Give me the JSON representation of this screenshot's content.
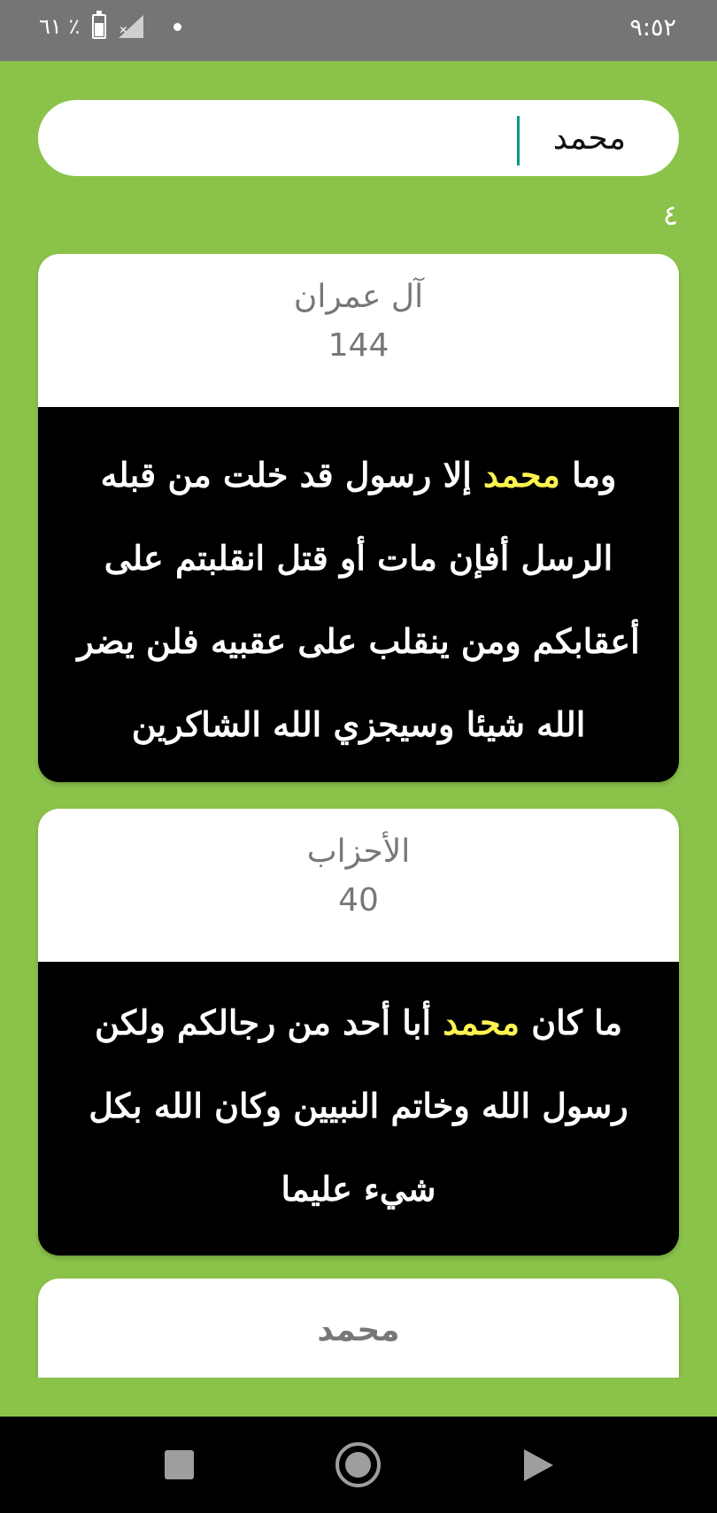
{
  "status_bar": {
    "time": "٩:٥٢",
    "battery": "٦١ ٪",
    "icons": [
      "battery-icon",
      "signal-icon",
      "dot-icon"
    ]
  },
  "search": {
    "value": "محمد",
    "placeholder": ""
  },
  "results_count": "٤",
  "results": [
    {
      "surah": "آل عمران",
      "ayah_number": "144",
      "text_before": "وما ",
      "highlight": "محمد",
      "text_after": " إلا رسول قد خلت من قبله الرسل أفإن مات أو قتل انقلبتم على أعقابكم ومن ينقلب على عقبيه فلن يضر الله شيئا وسيجزي الله الشاكرين"
    },
    {
      "surah": "الأحزاب",
      "ayah_number": "40",
      "text_before": "ما كان ",
      "highlight": "محمد",
      "text_after": " أبا أحد من رجالكم ولكن رسول الله وخاتم النبيين وكان الله بكل شيء عليما"
    },
    {
      "surah": "محمد"
    }
  ],
  "colors": {
    "background": "#8bc34a",
    "highlight": "#fff44f",
    "verse_background": "#000000",
    "cursor": "#009688"
  },
  "nav_bar": {
    "icons": [
      "recents-square-icon",
      "home-circle-icon",
      "back-triangle-icon"
    ]
  }
}
